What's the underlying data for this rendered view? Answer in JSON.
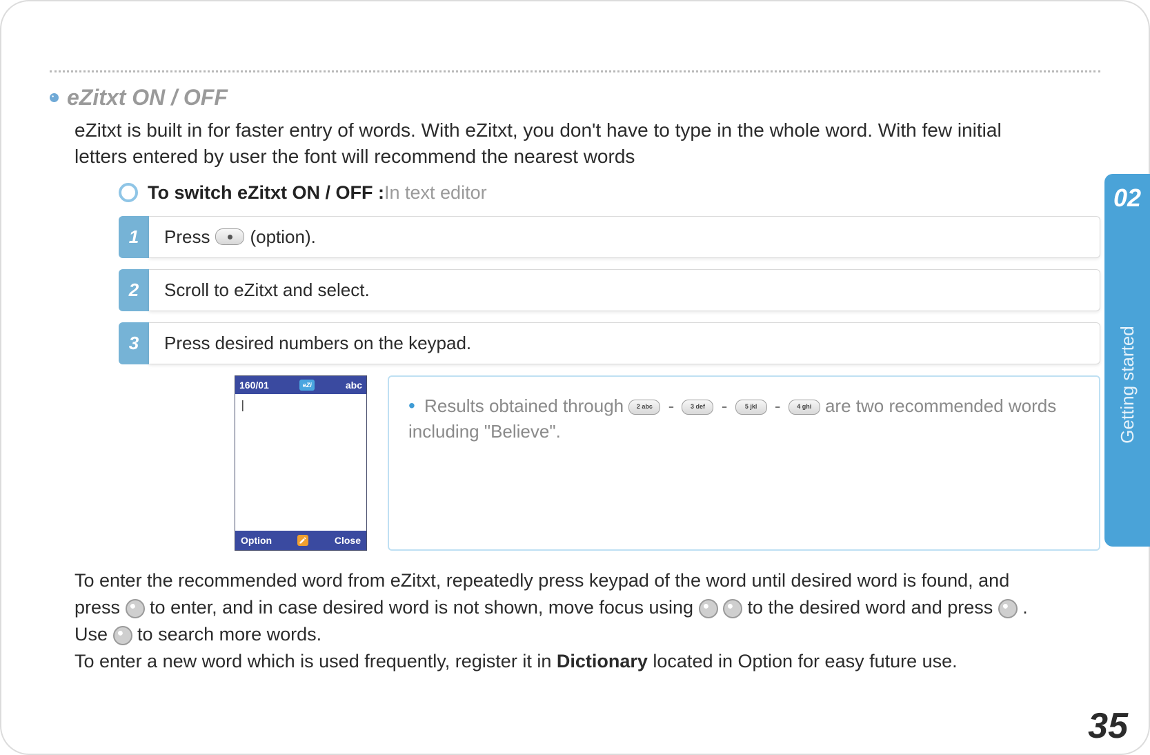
{
  "section": {
    "title": "eZitxt ON / OFF"
  },
  "intro": "eZitxt is built in for faster entry of words. With eZitxt, you don't have to type in the whole word. With few initial letters entered by user the font will recommend the nearest words",
  "lead": {
    "bold": "To switch eZitxt ON / OFF : ",
    "gray": "In text editor"
  },
  "steps": {
    "s1": {
      "num": "1",
      "before": "Press ",
      "after": " (option)."
    },
    "s2": {
      "num": "2",
      "text": "Scroll to eZitxt and select."
    },
    "s3": {
      "num": "3",
      "text": "Press desired numbers on the keypad."
    }
  },
  "phone": {
    "counter": "160/01",
    "mode": "abc",
    "cursor": "|",
    "softleft": "Option",
    "softright": "Close"
  },
  "keys": {
    "k2": "2 abc",
    "k3": "3 def",
    "k5": "5 jkl",
    "k4": "4 ghi"
  },
  "note": {
    "before": "Results obtained through ",
    "sep": " - ",
    "after": " are two recommended words including \"Believe\"."
  },
  "para": {
    "p1a": "To enter the recommended word from eZitxt, repeatedly press keypad of the word until desired word is found, and press ",
    "p1b": " to enter, and in case desired word is not shown, move focus using ",
    "p1c": " to the desired word and press ",
    "p1d": ".",
    "p2a": "Use ",
    "p2b": " to search more words.",
    "p3a": "To enter a new word which is used frequently, register it in ",
    "p3bold": "Dictionary",
    "p3b": " located in Option for easy future use."
  },
  "tab": {
    "chapter": "02",
    "label": "Getting started"
  },
  "page_number": "35"
}
